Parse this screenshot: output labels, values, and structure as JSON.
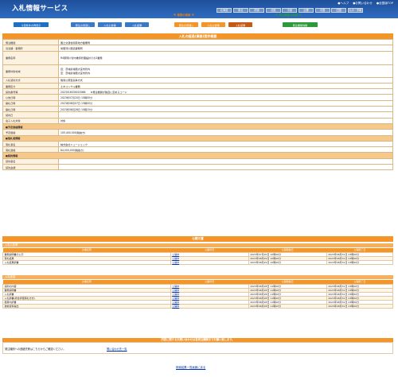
{
  "header": {
    "title": "入札情報サービス",
    "top_links": [
      "●ヘルプ",
      "●お問い合わせ",
      "●全国版TOP"
    ],
    "regions": [
      "北海道",
      "東北",
      "関東",
      "北陸",
      "中部",
      "近畿",
      "中国",
      "四国",
      "九州・沖縄"
    ],
    "menu_heads": [
      "※ 今回条件の検索 ※",
      "※ 工事の検索 ※",
      "※ 業務の検索 ※",
      "※ 発注機関の検索 ※"
    ],
    "menu_buttons": [
      {
        "label": "今回条件の再表示",
        "color": "#1f6fc7"
      },
      {
        "label": "発注の見通し",
        "color": "#3a79c8"
      },
      {
        "label": "入札公告等",
        "color": "#3a79c8"
      },
      {
        "label": "入札結果",
        "color": "#3a79c8"
      },
      {
        "label": "発注の見通し",
        "color": "#f4952a"
      },
      {
        "label": "入札公告等",
        "color": "#f4952a"
      },
      {
        "label": "入札結果",
        "color": "#c45a14"
      },
      {
        "label": "発注機関情報",
        "color": "#2a9a3a"
      }
    ]
  },
  "detail": {
    "title": "入札の経過(業務)案件概要",
    "rows": [
      {
        "k": "発注機関",
        "v": "国土交通省関東地方整備局"
      },
      {
        "k": "当当課・事務所",
        "v": "常陸河川国道事務所"
      },
      {
        "k": "業務名称",
        "v": "R4那珂川管内維持管理設計その2業務"
      },
      {
        "k": "業務対象地域",
        "v": "自：茨城県常陸大宮市管内\n至：茨城県常陸大宮市管内"
      },
      {
        "k": "入札契約方式",
        "v": "簡易公募型競争方式"
      },
      {
        "k": "業務区分",
        "v": "土木コンサル業務"
      },
      {
        "k": "契約番号等",
        "v": "2023016030020066　　★発注機関が独自に定めるコード"
      },
      {
        "k": "公告日時",
        "v": "2023年07月20日 10時00分"
      },
      {
        "k": "開札日時",
        "v": "2023年08月07日 15時00分"
      },
      {
        "k": "開札日時",
        "v": "2023年08月28日 10時15分"
      },
      {
        "k": "契約日",
        "v": ""
      },
      {
        "k": "電子入札対象",
        "v": "対象"
      },
      {
        "k": "■予定価格情報",
        "v": "",
        "group": true
      },
      {
        "k": "予定価格",
        "v": "105,400,000(税抜き)"
      },
      {
        "k": "■落札者情報",
        "v": "",
        "group": true
      },
      {
        "k": "落札者名",
        "v": "株式会社ニュージェック"
      },
      {
        "k": "落札価格",
        "v": "84,000,000(税抜き)"
      },
      {
        "k": "■契約情報",
        "v": "",
        "group": true
      },
      {
        "k": "契約者名",
        "v": ""
      },
      {
        "k": "契約金額",
        "v": ""
      }
    ]
  },
  "docs": {
    "title": "公開文書",
    "notice": {
      "sub": "入札公告等",
      "cols": [
        "文書名称",
        "公開状況",
        "公開開始日",
        "公開終了日"
      ],
      "rows": [
        [
          "業務説明書の公示",
          "公開中",
          "2023年07月20日 10時00分",
          "2023年08月31日 23時00分"
        ],
        [
          "落札結果",
          "公開中",
          "2023年08月29日 10時00分",
          "2023年08月31日 23時00分"
        ],
        [
          "入札結果調書",
          "公開中",
          "2023年08月29日 10時00分",
          "2023年08月31日 23時00分"
        ]
      ]
    },
    "result": {
      "sub": "入札経過",
      "cols": [
        "文書名称",
        "公開状況",
        "公開開始日",
        "公開終了日"
      ],
      "rows": [
        [
          "契約の内容",
          "公開中",
          "2023年08月28日 11時00分",
          "2023年08月31日 23時00分"
        ],
        [
          "業務説明書",
          "公開中",
          "2023年08月28日 11時00分",
          "2023年08月31日 23時00分"
        ],
        [
          "入札調書",
          "公開中",
          "2023年08月28日 11時00分",
          "2023年08月31日 23時00分"
        ],
        [
          "入札調書(総合評価落札方式)",
          "公開中",
          "2023年08月28日 11時00分",
          "2023年08月31日 23時00分"
        ],
        [
          "積算内訳書",
          "公開中",
          "2023年08月28日 11時00分",
          "2023年08月31日 23時00分"
        ],
        [
          "技術資料提出",
          "公開中",
          "2023年08月28日 11時00分",
          "2023年08月31日 23時00分"
        ]
      ]
    }
  },
  "contact": {
    "bar": "内容に関するお問い合わせは各発注機関までお願い致します。",
    "text": "発注機関への連絡先等はこちらからご確認ください。",
    "link": "問い合わせ先一覧"
  },
  "footer": {
    "link": "検索結果一覧画面に戻る"
  }
}
